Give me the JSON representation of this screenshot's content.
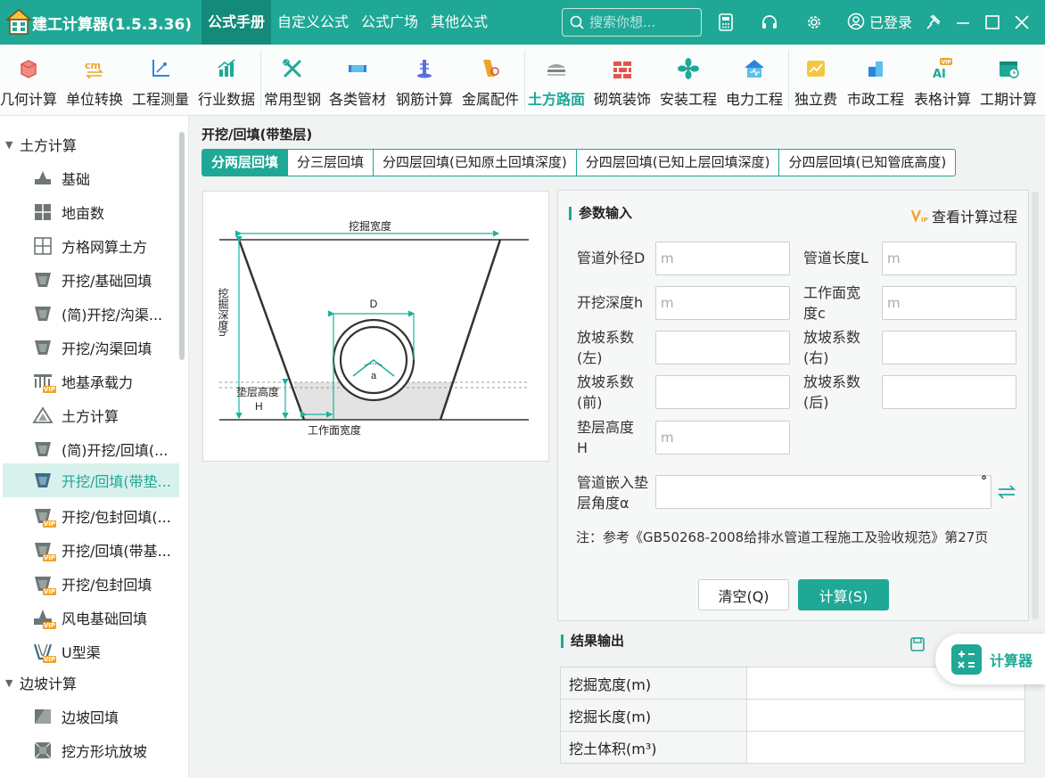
{
  "app": {
    "title": "建工计算器(1.5.3.36)"
  },
  "nav_tabs": [
    {
      "label": "公式手册",
      "active": true
    },
    {
      "label": "自定义公式",
      "active": false
    },
    {
      "label": "公式广场",
      "active": false
    },
    {
      "label": "其他公式",
      "active": false
    }
  ],
  "search": {
    "placeholder": "搜索你想..."
  },
  "user": {
    "login_label": "已登录"
  },
  "toolbar": [
    {
      "label": "几何计算",
      "icon": "cube-icon"
    },
    {
      "label": "单位转换",
      "icon": "unit-convert-icon"
    },
    {
      "label": "工程测量",
      "icon": "survey-icon"
    },
    {
      "label": "行业数据",
      "icon": "bar-chart-icon"
    },
    {
      "label": "常用型钢",
      "icon": "tools-icon"
    },
    {
      "label": "各类管材",
      "icon": "pipe-icon"
    },
    {
      "label": "钢筋计算",
      "icon": "rebar-icon"
    },
    {
      "label": "金属配件",
      "icon": "metal-fitting-icon"
    },
    {
      "label": "土方路面",
      "icon": "earthwork-icon",
      "active": true
    },
    {
      "label": "砌筑装饰",
      "icon": "brick-icon"
    },
    {
      "label": "安装工程",
      "icon": "fan-icon"
    },
    {
      "label": "电力工程",
      "icon": "power-house-icon"
    },
    {
      "label": "独立费",
      "icon": "fee-chart-icon"
    },
    {
      "label": "市政工程",
      "icon": "municipal-icon"
    },
    {
      "label": "表格计算",
      "icon": "vip-ai-icon"
    },
    {
      "label": "工期计算",
      "icon": "calendar-icon"
    }
  ],
  "sidebar": {
    "groups": [
      {
        "label": "土方计算",
        "items": [
          {
            "label": "基础",
            "icon": "foundation-icon"
          },
          {
            "label": "地亩数",
            "icon": "land-grid-icon"
          },
          {
            "label": "方格网算土方",
            "icon": "square-grid-icon"
          },
          {
            "label": "开挖/基础回填",
            "icon": "trench-icon"
          },
          {
            "label": "(简)开挖/沟渠...",
            "icon": "trench-icon"
          },
          {
            "label": "开挖/沟渠回填",
            "icon": "trench-icon"
          },
          {
            "label": "地基承载力",
            "icon": "bearing-vip-icon",
            "vip": true
          },
          {
            "label": "土方计算",
            "icon": "earth-pile-icon"
          },
          {
            "label": "(简)开挖/回填(...",
            "icon": "trench-icon"
          },
          {
            "label": "开挖/回填(带垫...",
            "icon": "trench-icon",
            "active": true
          },
          {
            "label": "开挖/包封回填(...",
            "icon": "trench-vip-icon",
            "vip": true
          },
          {
            "label": "开挖/回填(带基...",
            "icon": "trench-vip-icon",
            "vip": true
          },
          {
            "label": "开挖/包封回填",
            "icon": "trench-vip-icon",
            "vip": true
          },
          {
            "label": "风电基础回填",
            "icon": "wind-foundation-icon",
            "vip": true
          },
          {
            "label": "U型渠",
            "icon": "u-channel-icon",
            "vip": true
          }
        ]
      },
      {
        "label": "边坡计算",
        "items": [
          {
            "label": "边坡回填",
            "icon": "slope-icon"
          },
          {
            "label": "挖方形坑放坡",
            "icon": "pit-icon"
          }
        ]
      }
    ]
  },
  "main": {
    "title": "开挖/回填(带垫层)",
    "subtabs": [
      {
        "label": "分两层回填",
        "active": true
      },
      {
        "label": "分三层回填",
        "active": false
      },
      {
        "label": "分四层回填(已知原土回填深度)",
        "active": false
      },
      {
        "label": "分四层回填(已知上层回填深度)",
        "active": false
      },
      {
        "label": "分四层回填(已知管底高度)",
        "active": false
      }
    ],
    "diagram": {
      "top_label": "挖掘宽度",
      "depth_label": "挖掘深度h",
      "diameter_label": "D",
      "angle_label": "a",
      "cushion_label": "垫层高度",
      "cushion_sym": "H",
      "workface_label": "工作面宽度"
    }
  },
  "params": {
    "title": "参数输入",
    "view_process": "查看计算过程",
    "fields": [
      {
        "label": "管道外径D",
        "placeholder": "m",
        "value": ""
      },
      {
        "label": "管道长度L",
        "placeholder": "m",
        "value": ""
      },
      {
        "label": "开挖深度h",
        "placeholder": "m",
        "value": ""
      },
      {
        "label": "工作面宽度c",
        "placeholder": "m",
        "value": ""
      },
      {
        "label": "放坡系数(左)",
        "placeholder": "",
        "value": ""
      },
      {
        "label": "放坡系数(右)",
        "placeholder": "",
        "value": ""
      },
      {
        "label": "放坡系数(前)",
        "placeholder": "",
        "value": ""
      },
      {
        "label": "放坡系数(后)",
        "placeholder": "",
        "value": ""
      },
      {
        "label": "垫层高度H",
        "placeholder": "m",
        "value": ""
      },
      {
        "label": "管道嵌入垫层角度α",
        "placeholder": "",
        "value": "",
        "unit": "°"
      }
    ],
    "note": "注：参考《GB50268-2008给排水管道工程施工及验收规范》第27页",
    "clear_label": "清空(Q)",
    "calc_label": "计算(S)"
  },
  "results": {
    "title": "结果输出",
    "rows": [
      {
        "label": "挖掘宽度(m)",
        "value": ""
      },
      {
        "label": "挖掘长度(m)",
        "value": ""
      },
      {
        "label": "挖土体积(m³)",
        "value": ""
      }
    ]
  },
  "floating": {
    "label": "计算器"
  },
  "colors": {
    "accent": "#1fa896",
    "accent_dark": "#138a7a",
    "vip": "#f0a32a"
  }
}
